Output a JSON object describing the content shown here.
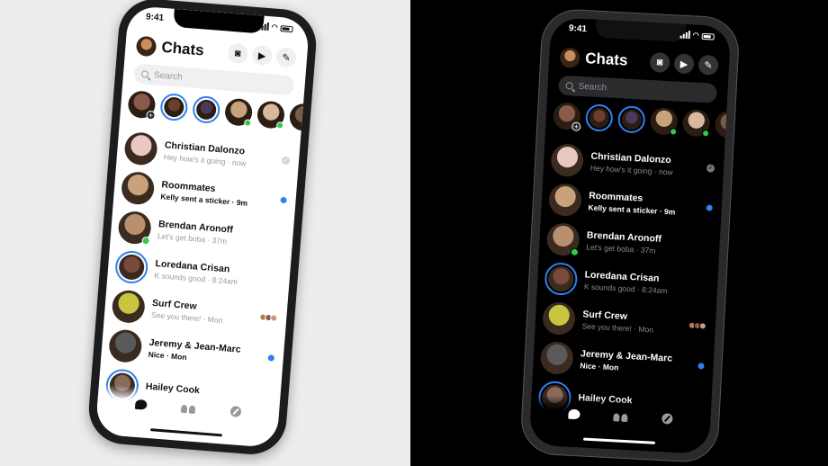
{
  "status": {
    "time": "9:41"
  },
  "header": {
    "title": "Chats",
    "camera_icon": "camera-icon",
    "video_icon": "video-icon",
    "compose_icon": "compose-icon"
  },
  "search": {
    "placeholder": "Search"
  },
  "stories": [
    {
      "kind": "add",
      "color": "#8a5a4a"
    },
    {
      "kind": "ring",
      "color": "#6b3f2a"
    },
    {
      "kind": "ring",
      "color": "#4a3a5a"
    },
    {
      "kind": "online",
      "color": "#c7a27a"
    },
    {
      "kind": "online",
      "color": "#d9b8a0"
    },
    {
      "kind": "plain",
      "color": "#7a5a48"
    }
  ],
  "chats": [
    {
      "name": "Christian Dalonzo",
      "preview": "Hey how's it going · now",
      "unread": false,
      "status": "seen",
      "color": "#e8c8c0"
    },
    {
      "name": "Roommates",
      "preview": "Kelly sent a sticker · 9m",
      "unread": true,
      "status": "dot",
      "color": "#c9a27a"
    },
    {
      "name": "Brendan Aronoff",
      "preview": "Let's get boba · 37m",
      "unread": false,
      "status": "none",
      "online": true,
      "color": "#b89070"
    },
    {
      "name": "Loredana Crisan",
      "preview": "K sounds good · 8:24am",
      "unread": false,
      "status": "none",
      "ring": true,
      "color": "#7a4a3a"
    },
    {
      "name": "Surf Crew",
      "preview": "See you there! · Mon",
      "unread": false,
      "status": "minis",
      "color": "#c8c640"
    },
    {
      "name": "Jeremy & Jean-Marc",
      "preview": "Nice · Mon",
      "unread": true,
      "status": "dot",
      "color": "#5a5a5a"
    },
    {
      "name": "Hailey Cook",
      "preview": "",
      "unread": false,
      "status": "none",
      "ring": true,
      "color": "#8a6a5a"
    }
  ],
  "tabbar": {
    "chats_icon": "chat-bubble-icon",
    "people_icon": "people-icon",
    "discover_icon": "compass-icon"
  },
  "colors": {
    "accent": "#2f80ed",
    "online": "#31cc46",
    "light_bg": "#ffffff",
    "dark_bg": "#000000"
  }
}
